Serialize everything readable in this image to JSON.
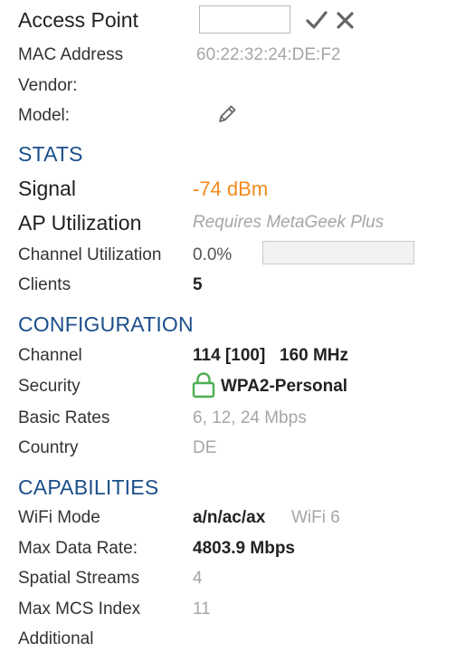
{
  "access_point": {
    "label": "Access Point",
    "name_input_value": "",
    "confirm_icon": "checkmark-icon",
    "cancel_icon": "close-icon"
  },
  "mac": {
    "label": "MAC Address",
    "value": "60:22:32:24:DE:F2"
  },
  "vendor": {
    "label": "Vendor:",
    "value": ""
  },
  "model": {
    "label": "Model:",
    "edit_icon": "pencil-icon"
  },
  "stats": {
    "heading": "STATS",
    "signal": {
      "label": "Signal",
      "value": "-74 dBm",
      "color": "#f28a1c"
    },
    "ap_utilization": {
      "label": "AP Utilization",
      "value": "Requires MetaGeek Plus"
    },
    "channel_utilization": {
      "label": "Channel Utilization",
      "value": "0.0%",
      "fraction": 0.0
    },
    "clients": {
      "label": "Clients",
      "value": "5"
    }
  },
  "configuration": {
    "heading": "CONFIGURATION",
    "channel": {
      "label": "Channel",
      "value": "114 [100]",
      "width": "160 MHz"
    },
    "security": {
      "label": "Security",
      "value": "WPA2-Personal",
      "icon": "lock-icon",
      "icon_color": "#4caf50"
    },
    "basic_rates": {
      "label": "Basic Rates",
      "value": "6, 12, 24 Mbps"
    },
    "country": {
      "label": "Country",
      "value": "DE"
    }
  },
  "capabilities": {
    "heading": "CAPABILITIES",
    "wifi_mode": {
      "label": "WiFi Mode",
      "value": "a/n/ac/ax",
      "generation": "WiFi 6"
    },
    "max_data_rate": {
      "label": "Max Data Rate:",
      "value": "4803.9 Mbps"
    },
    "spatial_streams": {
      "label": "Spatial Streams",
      "value": "4"
    },
    "max_mcs_index": {
      "label": "Max MCS Index",
      "value": "11"
    },
    "additional": {
      "label": "Additional",
      "value": ""
    }
  },
  "colors": {
    "section_heading": "#1b4f8a",
    "muted_text": "#a6a6a6",
    "accent_orange": "#f28a1c",
    "lock_green": "#4caf50"
  }
}
